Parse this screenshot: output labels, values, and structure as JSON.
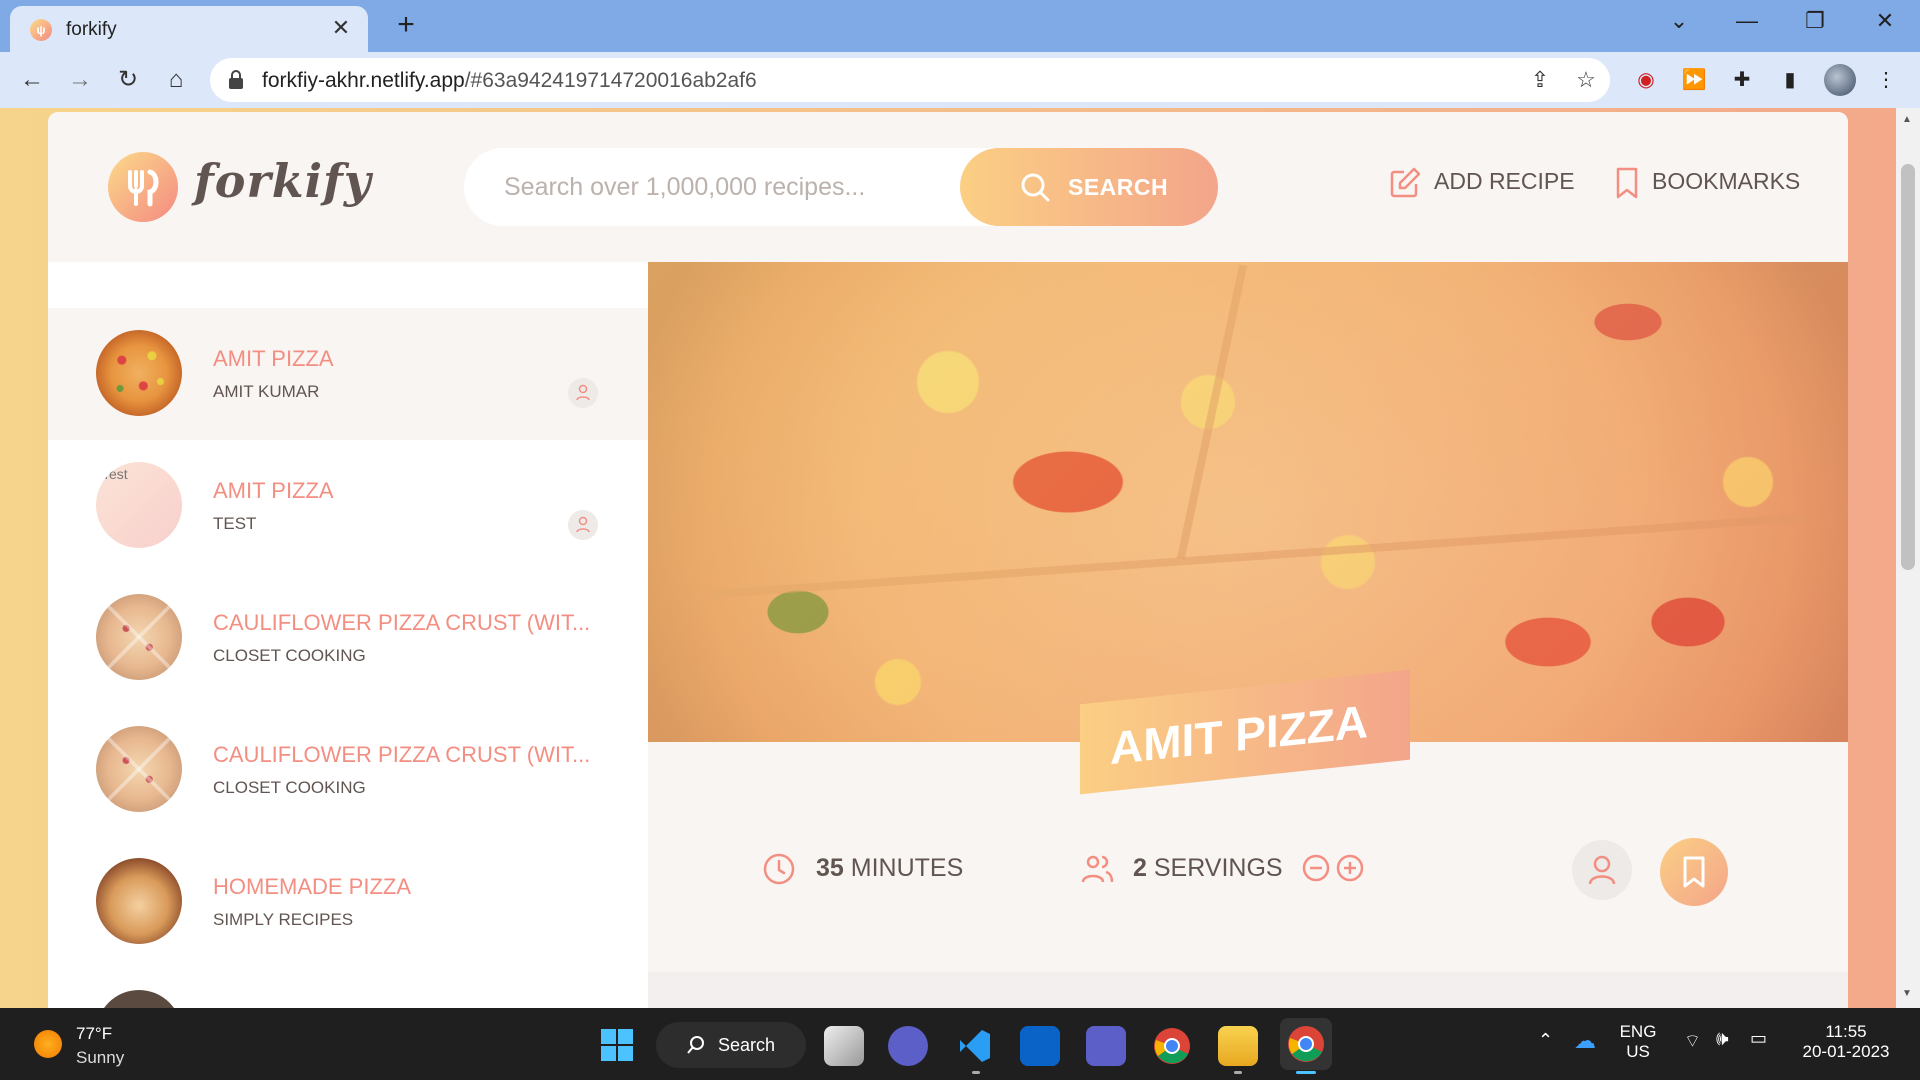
{
  "browser": {
    "tab_title": "forkify",
    "url_host": "forkfiy-akhr.netlify.app",
    "url_path": "/#63a942419714720016ab2af6"
  },
  "header": {
    "logo_text": "forkify",
    "search_placeholder": "Search over 1,000,000 recipes...",
    "search_button": "SEARCH",
    "add_recipe": "ADD RECIPE",
    "bookmarks": "BOOKMARKS"
  },
  "results": [
    {
      "title": "AMIT PIZZA",
      "publisher": "AMIT KUMAR",
      "user_generated": true,
      "image": "pizza",
      "active": true
    },
    {
      "title": "AMIT PIZZA",
      "publisher": "TEST",
      "user_generated": true,
      "image": "broken",
      "image_alt": "Test"
    },
    {
      "title": "CAULIFLOWER PIZZA CRUST (WIT...",
      "publisher": "CLOSET COOKING",
      "user_generated": false,
      "image": "cauli"
    },
    {
      "title": "CAULIFLOWER PIZZA CRUST (WIT...",
      "publisher": "CLOSET COOKING",
      "user_generated": false,
      "image": "cauli"
    },
    {
      "title": "HOMEMADE PIZZA",
      "publisher": "SIMPLY RECIPES",
      "user_generated": false,
      "image": "homemade"
    }
  ],
  "recipe": {
    "title": "AMIT PIZZA",
    "minutes": "35",
    "minutes_label": "MINUTES",
    "servings": "2",
    "servings_label": "SERVINGS"
  },
  "taskbar": {
    "weather_temp": "77°F",
    "weather_cond": "Sunny",
    "search_label": "Search",
    "lang_line1": "ENG",
    "lang_line2": "US",
    "time": "11:55",
    "date": "20-01-2023"
  },
  "colors": {
    "accent_start": "#fbdb89",
    "accent_end": "#f48982",
    "title_color": "#f38e82",
    "text_color": "#615551"
  }
}
